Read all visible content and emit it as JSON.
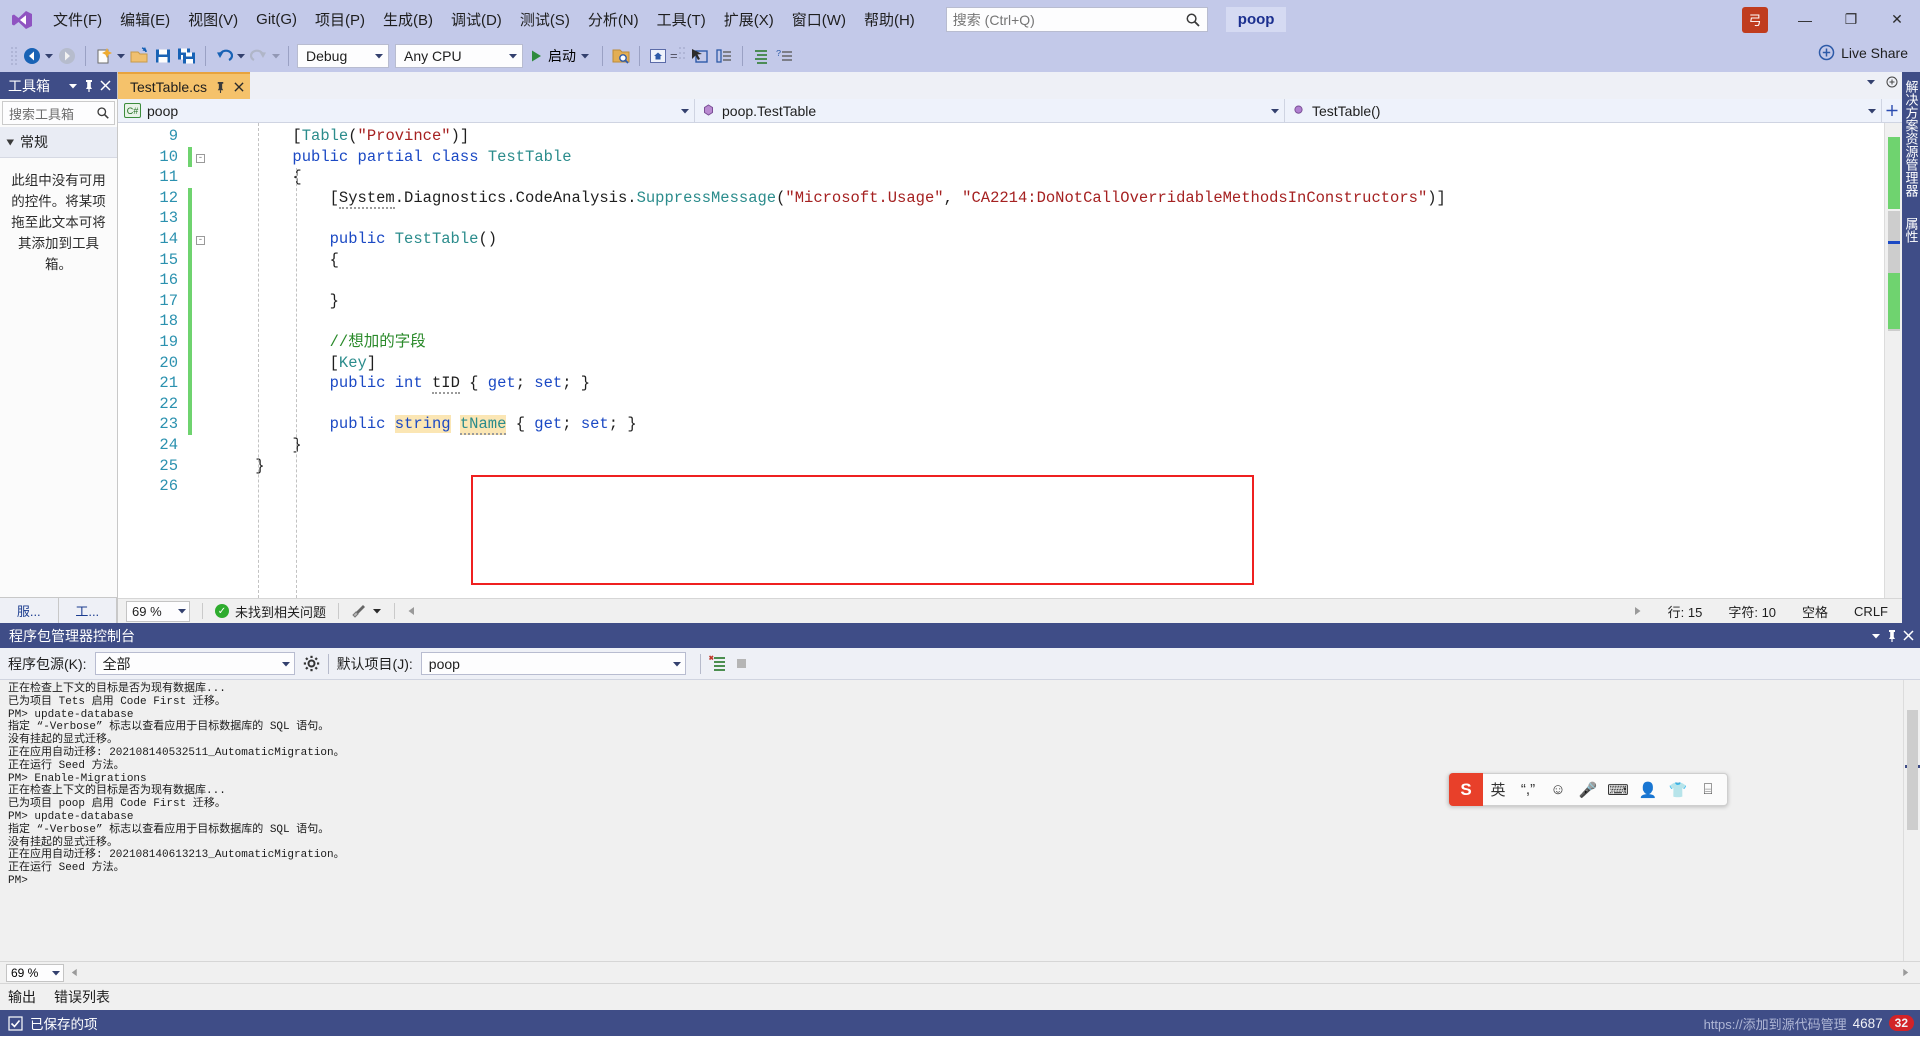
{
  "titlebar": {
    "menus": [
      {
        "label": "文件(F)"
      },
      {
        "label": "编辑(E)"
      },
      {
        "label": "视图(V)"
      },
      {
        "label": "Git(G)"
      },
      {
        "label": "项目(P)"
      },
      {
        "label": "生成(B)"
      },
      {
        "label": "调试(D)"
      },
      {
        "label": "测试(S)"
      },
      {
        "label": "分析(N)"
      },
      {
        "label": "工具(T)"
      },
      {
        "label": "扩展(X)"
      },
      {
        "label": "窗口(W)"
      },
      {
        "label": "帮助(H)"
      }
    ],
    "search_placeholder": "搜索 (Ctrl+Q)",
    "solution_name": "poop",
    "account_initial": "弓",
    "minimize": "—",
    "maximize": "❐",
    "close": "✕"
  },
  "toolbar": {
    "config": "Debug",
    "platform": "Any CPU",
    "run_label": "启动",
    "live_share": "Live Share"
  },
  "toolbox": {
    "title": "工具箱",
    "search_placeholder": "搜索工具箱",
    "group_label": "常规",
    "empty_message": "此组中没有可用的控件。将某项拖至此文本可将其添加到工具箱。",
    "bottom_tabs": [
      "服...",
      "工..."
    ]
  },
  "editor": {
    "tab_title": "TestTable.cs",
    "nav": {
      "project": "poop",
      "type": "poop.TestTable",
      "member": "TestTable()",
      "cs_badge": "C#"
    },
    "first_line_number": 9,
    "lines": [
      {
        "n": 9,
        "changed": false,
        "fold": "",
        "html": "        [<span class=\"attr\">Table</span>(<span class=\"str\">\"Province\"</span>)]"
      },
      {
        "n": 10,
        "changed": true,
        "fold": "-",
        "html": "        <span class=\"kw\">public</span> <span class=\"kw\">partial</span> <span class=\"kw\">class</span> <span class=\"ty\">TestTable</span>"
      },
      {
        "n": 11,
        "changed": false,
        "fold": "",
        "html": "        {"
      },
      {
        "n": 12,
        "changed": true,
        "fold": "",
        "html": "            [<span class=\"sq\">System</span>.Diagnostics.CodeAnalysis.<span class=\"attr\">SuppressMessage</span>(<span class=\"str\">\"Microsoft.Usage\"</span>, <span class=\"str\">\"CA2214:DoNotCallOverridableMethodsInConstructors\"</span>)]"
      },
      {
        "n": 13,
        "changed": true,
        "fold": "",
        "html": ""
      },
      {
        "n": 14,
        "changed": true,
        "fold": "-",
        "html": "            <span class=\"kw\">public</span> <span class=\"ty\">TestTable</span>()"
      },
      {
        "n": 15,
        "changed": true,
        "fold": "",
        "html": "            {"
      },
      {
        "n": 16,
        "changed": true,
        "fold": "",
        "html": ""
      },
      {
        "n": 17,
        "changed": true,
        "fold": "",
        "html": "            }"
      },
      {
        "n": 18,
        "changed": true,
        "fold": "",
        "html": ""
      },
      {
        "n": 19,
        "changed": true,
        "fold": "",
        "html": "            <span class=\"cmt\">//想加的字段</span>"
      },
      {
        "n": 20,
        "changed": true,
        "fold": "",
        "html": "            [<span class=\"attr\">Key</span>]"
      },
      {
        "n": 21,
        "changed": true,
        "fold": "",
        "html": "            <span class=\"kw\">public</span> <span class=\"kw\">int</span> <span class=\"sq\">tID</span> { <span class=\"kw\">get</span>; <span class=\"kw\">set</span>; }"
      },
      {
        "n": 22,
        "changed": true,
        "fold": "",
        "html": ""
      },
      {
        "n": 23,
        "changed": true,
        "fold": "",
        "html": "            <span class=\"kw\">public</span> <span class=\"kw hl\">string</span> <span class=\"ty hl sq\">tName</span> { <span class=\"kw\">get</span>; <span class=\"kw\">set</span>; }"
      },
      {
        "n": 24,
        "changed": false,
        "fold": "",
        "html": "        }"
      },
      {
        "n": 25,
        "changed": false,
        "fold": "",
        "html": "    }"
      },
      {
        "n": 26,
        "changed": false,
        "fold": "",
        "html": ""
      }
    ],
    "status": {
      "zoom": "69 %",
      "issues": "未找到相关问题",
      "line": "行: 15",
      "col": "字符: 10",
      "spaces": "空格",
      "eol": "CRLF"
    }
  },
  "rail": {
    "labels": [
      "解决方案资源管理器",
      "属性"
    ]
  },
  "console": {
    "title": "程序包管理器控制台",
    "source_label": "程序包源(K):",
    "source_value": "全部",
    "project_label": "默认项目(J):",
    "project_value": "poop",
    "zoom": "69 %",
    "output_lines": [
      "正在检查上下文的目标是否为现有数据库...",
      "已为项目 Tets 启用 Code First 迁移。",
      "PM> update-database",
      "指定 “-Verbose” 标志以查看应用于目标数据库的 SQL 语句。",
      "没有挂起的显式迁移。",
      "正在应用自动迁移: 202108140532511_AutomaticMigration。",
      "正在运行 Seed 方法。",
      "PM> Enable-Migrations",
      "正在检查上下文的目标是否为现有数据库...",
      "已为项目 poop 启用 Code First 迁移。",
      "PM> update-database",
      "指定 “-Verbose” 标志以查看应用于目标数据库的 SQL 语句。",
      "没有挂起的显式迁移。",
      "正在应用自动迁移: 202108140613213_AutomaticMigration。",
      "正在运行 Seed 方法。",
      "PM>"
    ]
  },
  "ime": {
    "logo": "S",
    "mode": "英",
    "punct": "“,”",
    "emoji": "☺",
    "mic": "🎤",
    "keyboard": "⌨",
    "person": "👤",
    "shirt": "👕",
    "grid": "⌸"
  },
  "bottom": {
    "tabs": [
      "输出",
      "错误列表"
    ],
    "status_text": "已保存的项",
    "url_hint": "https://添加到源代码管理",
    "count": "4687",
    "badge": "32"
  },
  "colors": {
    "accent": "#3f4d87",
    "chrome": "#c3c9e9",
    "tab_active": "#f5c26b",
    "highlight": "#fbe6b4",
    "redbox": "#ef2020",
    "keyword": "#1b49c4",
    "type": "#2b8c8c",
    "string": "#a52121",
    "comment": "#2a8a2a",
    "linenum": "#2b91af"
  }
}
